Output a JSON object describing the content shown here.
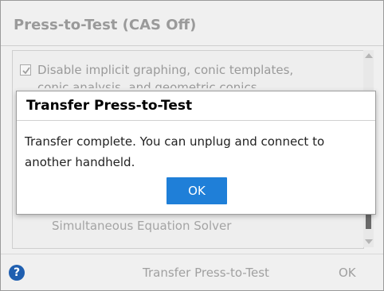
{
  "dialog": {
    "title": "Press-to-Test (CAS Off)",
    "option": {
      "line1": "Disable implicit graphing, conic templates,",
      "line2": "conic analysis, and geometric conics",
      "checked": true
    },
    "solver_label": "Simultaneous Equation Solver",
    "footer": {
      "help_icon": "question-mark-icon",
      "help_glyph": "?",
      "transfer_label": "Transfer Press-to-Test",
      "ok_label": "OK"
    }
  },
  "modal": {
    "title": "Transfer Press-to-Test",
    "message": "Transfer complete. You can unplug and connect to another handheld.",
    "ok_label": "OK"
  },
  "colors": {
    "accent": "#1f7fd8",
    "help_icon": "#1f5fb0",
    "disabled_text": "#9a9a9a"
  }
}
